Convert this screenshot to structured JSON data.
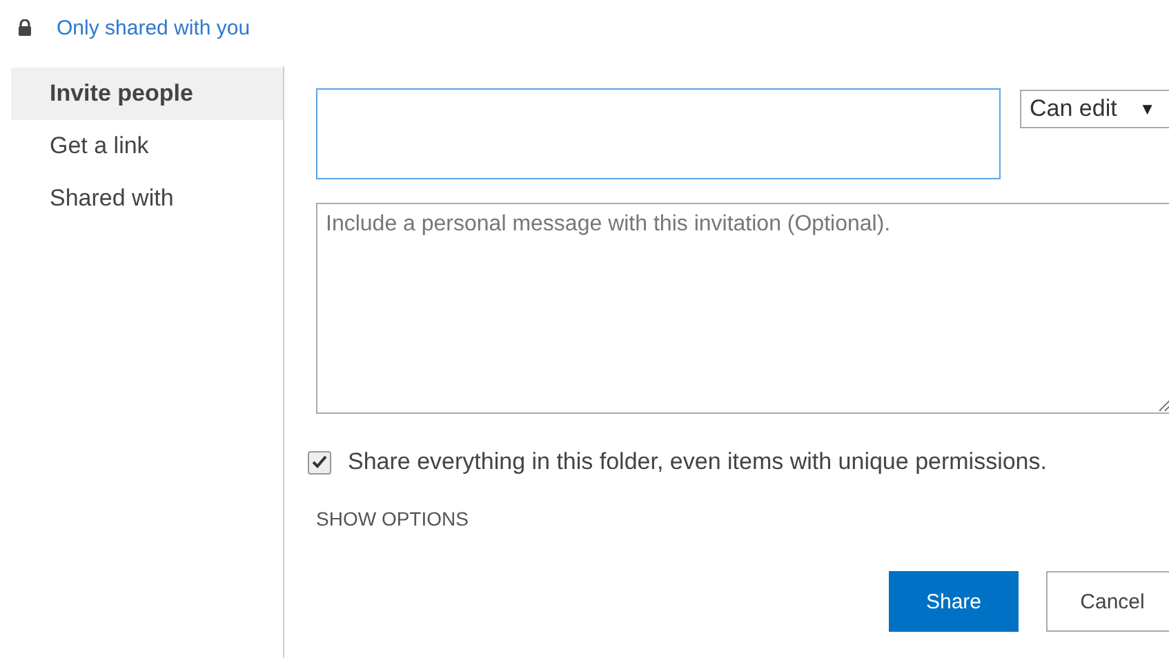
{
  "header": {
    "label": "Only shared with you"
  },
  "sidebar": {
    "items": [
      {
        "label": "Invite people",
        "selected": true
      },
      {
        "label": "Get a link",
        "selected": false
      },
      {
        "label": "Shared with",
        "selected": false
      }
    ]
  },
  "permission_dropdown": {
    "value": "Can edit",
    "arrow": "▼"
  },
  "message_field": {
    "placeholder": "Include a personal message with this invitation (Optional)."
  },
  "share_everything": {
    "label": "Share everything in this folder, even items with unique permissions.",
    "checked": true
  },
  "show_options": "SHOW OPTIONS",
  "buttons": [
    {
      "label": "Share",
      "kind": "primary"
    },
    {
      "label": "Cancel",
      "kind": "secondary"
    }
  ]
}
